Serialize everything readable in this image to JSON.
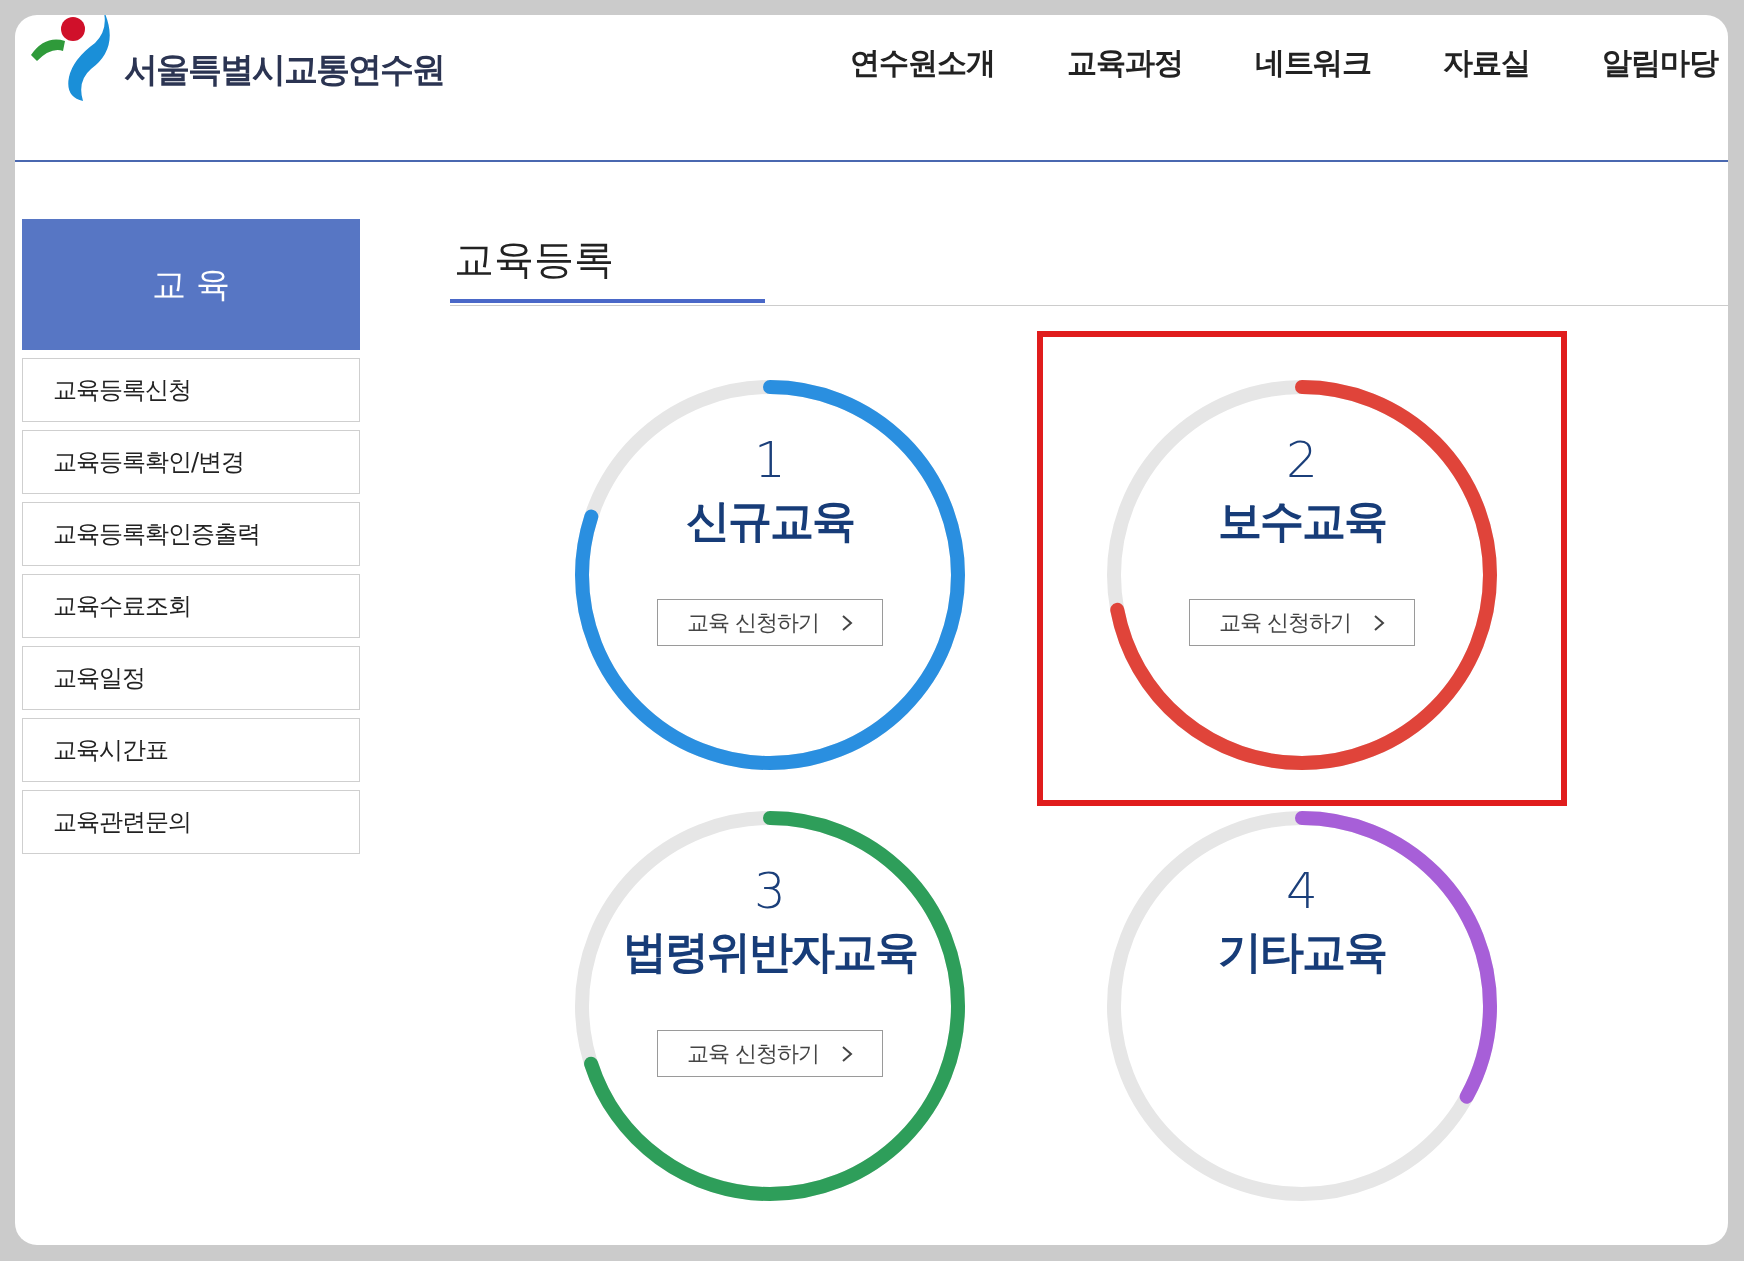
{
  "header": {
    "logo_text": "서울특별시교통연수원",
    "nav": [
      "연수원소개",
      "교육과정",
      "네트워크",
      "자료실",
      "알림마당"
    ]
  },
  "sidebar": {
    "title": "교 육",
    "items": [
      {
        "label": "교육등록신청"
      },
      {
        "label": "교육등록확인/변경"
      },
      {
        "label": "교육등록확인증출력"
      },
      {
        "label": "교육수료조회"
      },
      {
        "label": "교육일정"
      },
      {
        "label": "교육시간표"
      },
      {
        "label": "교육관련문의"
      }
    ]
  },
  "main": {
    "title": "교육등록",
    "cards": [
      {
        "number": "1",
        "title": "신규교육",
        "button": "교육 신청하기",
        "color": "#2a8fe0",
        "level": 0.8,
        "highlighted": false
      },
      {
        "number": "2",
        "title": "보수교육",
        "button": "교육 신청하기",
        "color": "#e0443a",
        "level": 0.72,
        "highlighted": true
      },
      {
        "number": "3",
        "title": "법령위반자교육",
        "button": "교육 신청하기",
        "color": "#2e9e5a",
        "level": 0.7,
        "highlighted": false
      },
      {
        "number": "4",
        "title": "기타교육",
        "color": "#a75fd8",
        "level": 0.33,
        "highlighted": false
      }
    ]
  }
}
